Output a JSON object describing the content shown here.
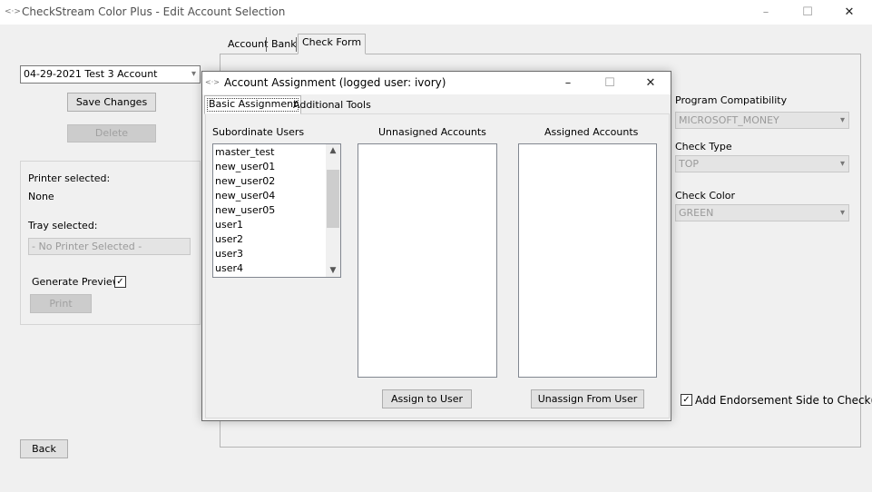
{
  "window": {
    "title": "CheckStream Color Plus - Edit Account Selection",
    "controls": {
      "minimize": "–",
      "maximize": "☐",
      "close": "✕"
    }
  },
  "left_panel": {
    "account_select": "04-29-2021 Test 3 Account",
    "save_label": "Save Changes",
    "delete_label": "Delete",
    "printer_label": "Printer selected:",
    "printer_value": "None",
    "tray_label": "Tray selected:",
    "tray_value": "- No Printer Selected -",
    "preview_label": "Generate Preview",
    "preview_checked": "✓",
    "print_label": "Print",
    "back_label": "Back"
  },
  "main_tabs": [
    "Account",
    "Bank",
    "Check Form"
  ],
  "right_panel": {
    "compat_label": "Program Compatibility",
    "compat_value": "MICROSOFT_MONEY",
    "type_label": "Check Type",
    "type_value": "TOP",
    "color_label": "Check Color",
    "color_value": "GREEN",
    "endorse_label": "Add Endorsement Side to Check(s)",
    "endorse_checked": "✓"
  },
  "dialog": {
    "title": "Account Assignment (logged user: ivory)",
    "tabs": [
      "Basic Assignment",
      "Additional Tools"
    ],
    "subordinate_header": "Subordinate Users",
    "unassigned_header": "Unnasigned Accounts",
    "assigned_header": "Assigned Accounts",
    "users": [
      "master_test",
      "new_user01",
      "new_user02",
      "new_user04",
      "new_user05",
      "user1",
      "user2",
      "user3",
      "user4"
    ],
    "assign_label": "Assign to User",
    "unassign_label": "Unassign From User"
  }
}
